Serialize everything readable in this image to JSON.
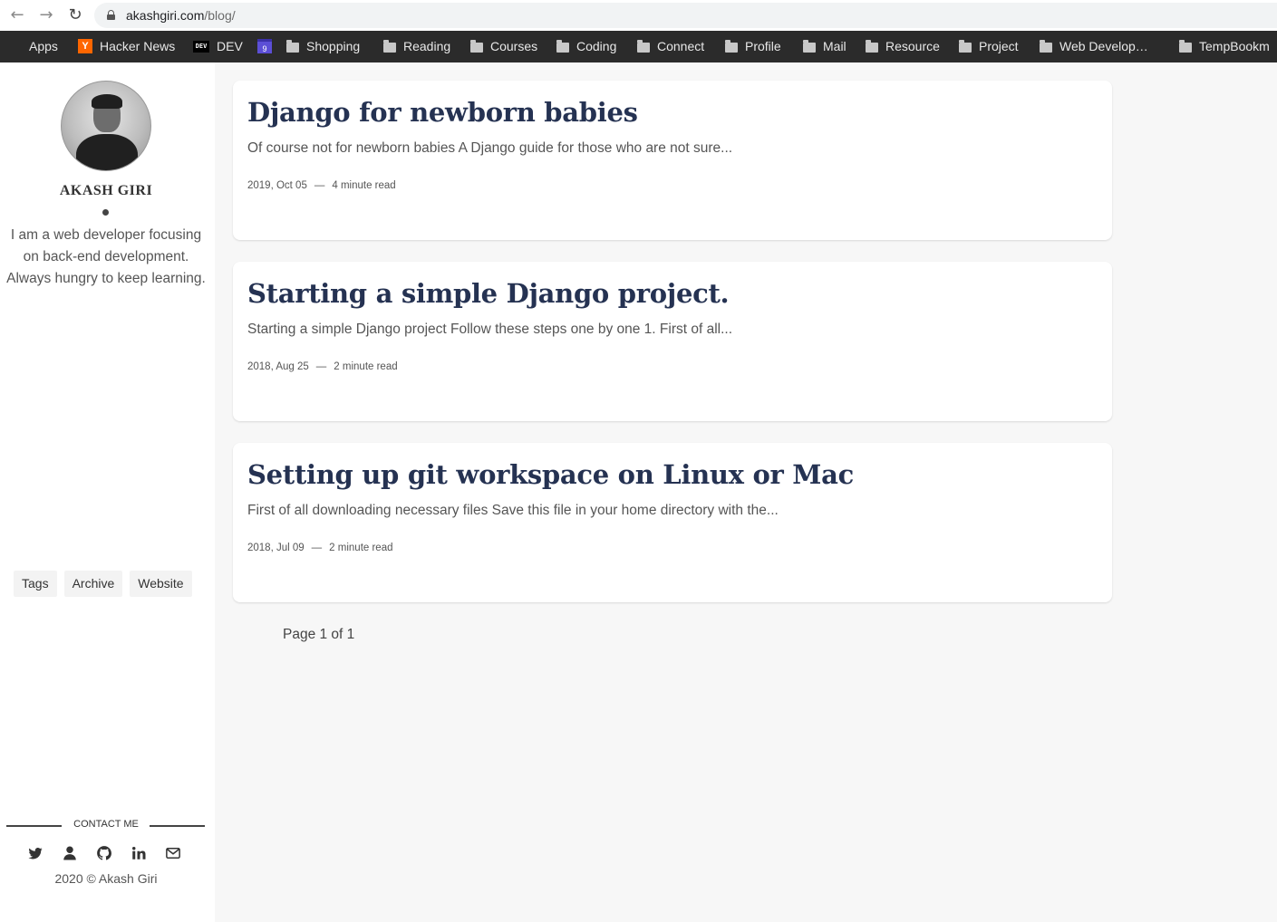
{
  "browser": {
    "url_domain": "akashgiri.com",
    "url_path": "/blog/",
    "bookmarks": [
      {
        "label": "Apps",
        "icon": "apps-icon"
      },
      {
        "label": "Hacker News",
        "icon": "hacker-news-icon"
      },
      {
        "label": "DEV",
        "icon": "dev-icon"
      },
      {
        "label": "9",
        "icon": "calendar-icon"
      },
      {
        "label": "Shopping",
        "icon": "folder-icon"
      },
      {
        "label": "Reading",
        "icon": "folder-icon"
      },
      {
        "label": "Courses",
        "icon": "folder-icon"
      },
      {
        "label": "Coding",
        "icon": "folder-icon"
      },
      {
        "label": "Connect",
        "icon": "folder-icon"
      },
      {
        "label": "Profile",
        "icon": "folder-icon"
      },
      {
        "label": "Mail",
        "icon": "folder-icon"
      },
      {
        "label": "Resource",
        "icon": "folder-icon"
      },
      {
        "label": "Project",
        "icon": "folder-icon"
      },
      {
        "label": "Web Develop…",
        "icon": "folder-icon"
      },
      {
        "label": "TempBookm",
        "icon": "folder-icon"
      }
    ]
  },
  "sidebar": {
    "name": "AKASH GIRI",
    "bio": "I am a web developer focusing on back-end development. Always hungry to keep learning.",
    "links": [
      "Tags",
      "Archive",
      "Website"
    ],
    "contact_label": "CONTACT ME",
    "socials": [
      "twitter-icon",
      "user-icon",
      "github-icon",
      "linkedin-icon",
      "mail-icon"
    ],
    "copyright": "2020 © Akash Giri"
  },
  "posts": [
    {
      "title": "Django for newborn babies",
      "excerpt": "Of course not for newborn babies A Django guide for those who are not sure...",
      "date": "2019, Oct 05",
      "read_time": "4 minute read"
    },
    {
      "title": "Starting a simple Django project.",
      "excerpt": "Starting a simple Django project Follow these steps one by one 1. First of all...",
      "date": "2018, Aug 25",
      "read_time": "2 minute read"
    },
    {
      "title": "Setting up git workspace on Linux or Mac",
      "excerpt": "First of all downloading necessary files Save this file in your home directory with the...",
      "date": "2018, Jul 09",
      "read_time": "2 minute read"
    }
  ],
  "meta_separator": "—",
  "pagination": "Page 1 of 1",
  "colors": {
    "title": "#253252",
    "bookmark_bar": "#2b2b2b",
    "page_bg": "#f7f7f7"
  }
}
